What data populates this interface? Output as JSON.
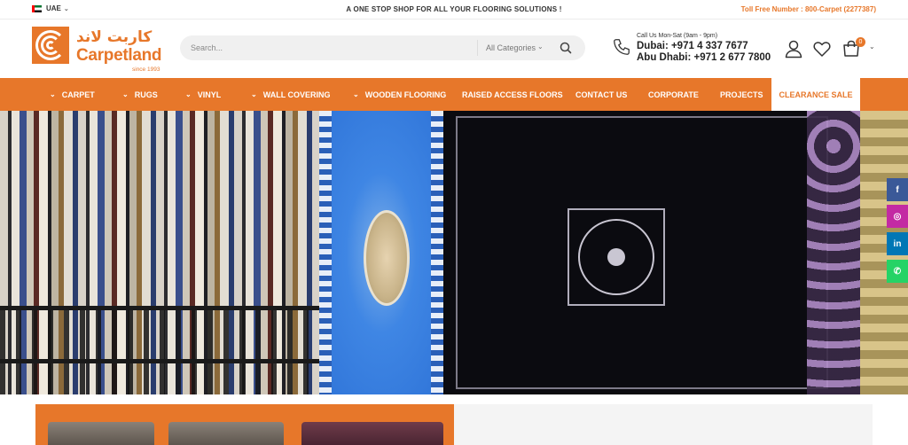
{
  "topbar": {
    "country": "UAE",
    "tagline": "A ONE STOP SHOP FOR ALL YOUR FLOORING SOLUTIONS !",
    "tollfree": "Toll Free Number : 800-Carpet (2277387)"
  },
  "logo": {
    "arabic": "كاربت لاند",
    "name": "Carpetland",
    "since": "since 1993"
  },
  "search": {
    "placeholder": "Search...",
    "category": "All Categories"
  },
  "contact": {
    "hours": "Call Us Mon-Sat (9am - 9pm)",
    "dubai": "Dubai: +971 4 337 7677",
    "abu_dhabi": "Abu Dhabi: +971 2 677 7800"
  },
  "cart": {
    "count": "0"
  },
  "nav": {
    "items": [
      {
        "label": "CARPET",
        "has_dropdown": true
      },
      {
        "label": "RUGS",
        "has_dropdown": true
      },
      {
        "label": "VINYL",
        "has_dropdown": true
      },
      {
        "label": "WALL COVERING",
        "has_dropdown": true
      },
      {
        "label": "WOODEN FLOORING",
        "has_dropdown": true
      },
      {
        "label": "RAISED ACCESS FLOORS",
        "has_dropdown": false
      },
      {
        "label": "CONTACT US",
        "has_dropdown": false
      },
      {
        "label": "CORPORATE",
        "has_dropdown": false
      },
      {
        "label": "PROJECTS",
        "has_dropdown": false
      }
    ],
    "clearance": "CLEARANCE SALE"
  },
  "social": {
    "facebook": "f",
    "instagram": "◎",
    "linkedin": "in",
    "whatsapp": "✆"
  },
  "icons": [
    "flag-uae-icon",
    "search-icon",
    "phone-icon",
    "user-icon",
    "heart-icon",
    "cart-icon",
    "chevron-down-icon",
    "facebook-icon",
    "instagram-icon",
    "linkedin-icon",
    "whatsapp-icon"
  ],
  "colors": {
    "brand_orange": "#e7772a",
    "text_dark": "#222222"
  }
}
